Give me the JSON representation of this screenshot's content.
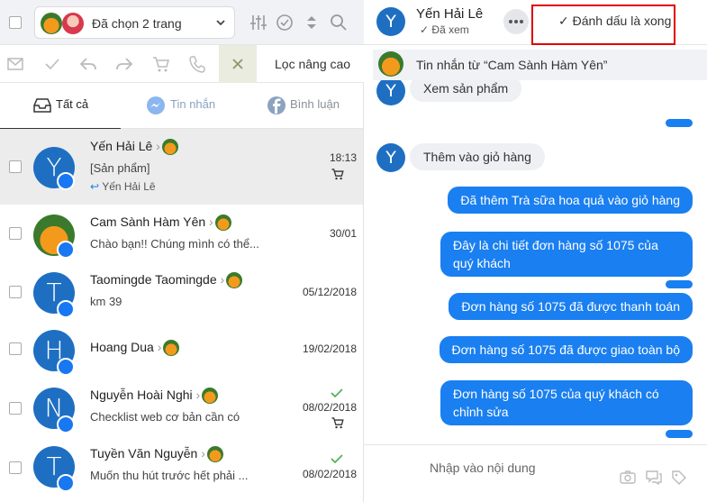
{
  "left": {
    "page_selector": {
      "label": "Đã chọn 2 trang"
    },
    "toolbar": {
      "advanced_filter": "Lọc nâng cao"
    },
    "tabs": [
      {
        "label": "Tất cả",
        "active": true
      },
      {
        "label": "Tin nhắn",
        "active": false
      },
      {
        "label": "Bình luận",
        "active": false
      }
    ],
    "conversations": [
      {
        "initial": "Y",
        "name": "Yến Hải Lê",
        "snippet": "[Sản phẩm]",
        "reply": "Yến Hải Lê",
        "date": "18:13",
        "cart": true,
        "check": false,
        "selected": true
      },
      {
        "initial": "",
        "name": "Cam Sành Hàm Yên",
        "snippet": "Chào bạn!! Chúng mình có thể...",
        "reply": "",
        "date": "30/01",
        "cart": false,
        "check": false,
        "selected": false
      },
      {
        "initial": "T",
        "name": "Taomingde Taomingde",
        "snippet": "km 39",
        "reply": "",
        "date": "05/12/2018",
        "cart": false,
        "check": false,
        "selected": false
      },
      {
        "initial": "H",
        "name": "Hoang Dua",
        "snippet": "",
        "reply": "",
        "date": "19/02/2018",
        "cart": false,
        "check": false,
        "selected": false
      },
      {
        "initial": "N",
        "name": "Nguyễn Hoài Nghi",
        "snippet": "Checklist web cơ bản cần có",
        "reply": "",
        "date": "08/02/2018",
        "cart": true,
        "check": true,
        "selected": false
      },
      {
        "initial": "T",
        "name": "Tuyền Văn Nguyễn",
        "snippet": "Muốn thu hút trước hết phải ...",
        "reply": "",
        "date": "08/02/2018",
        "cart": false,
        "check": true,
        "selected": false
      }
    ]
  },
  "right": {
    "header": {
      "initial": "Y",
      "name": "Yến Hải Lê",
      "seen": "Đã xem",
      "mark_done": "Đánh dấu là xong"
    },
    "from_page": "Tin nhắn từ  “Cam Sành Hàm Yên”",
    "messages": [
      {
        "dir": "in",
        "text": "Xem sản phẩm"
      },
      {
        "dir": "in",
        "text": "Thêm vào giỏ hàng"
      },
      {
        "dir": "out",
        "text": "Đã thêm Trà sữa hoa quả vào giỏ hàng"
      },
      {
        "dir": "out",
        "text": "Đây là chi tiết đơn hàng số 1075 của quý khách"
      },
      {
        "dir": "out",
        "text": "Đơn hàng số 1075 đã được thanh toán"
      },
      {
        "dir": "out",
        "text": "Đơn hàng số 1075 đã được giao toàn bộ"
      },
      {
        "dir": "out",
        "text": "Đơn hàng số 1075 của quý khách có chỉnh sửa"
      }
    ],
    "composer": {
      "placeholder": "Nhập vào nội dung"
    }
  },
  "colors": {
    "accent": "#1a7ff0",
    "avatar": "#1e6fc2",
    "highlight_box": "#dd0000",
    "selected_row": "#ececec"
  }
}
